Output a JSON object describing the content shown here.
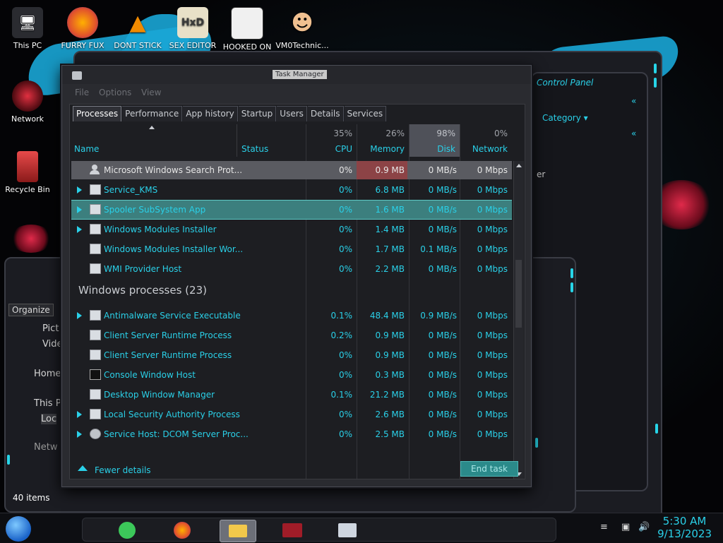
{
  "desktop": {
    "icons": [
      {
        "label": "This PC"
      },
      {
        "label": "FURRY FUX"
      },
      {
        "label": "DONT STICK"
      },
      {
        "label": "SEX EDITOR"
      },
      {
        "label": "HOOKED ON"
      },
      {
        "label": "VM0Technic..."
      },
      {
        "label": "Network"
      },
      {
        "label": "Recycle Bin"
      }
    ]
  },
  "control_panel": {
    "label": "Control Panel",
    "category": "Category",
    "partial": "er"
  },
  "explorer": {
    "organize": "Organize",
    "items": [
      "Pict",
      "Vide",
      "Home",
      "This P",
      "Loc",
      "Netw"
    ],
    "status_items": "40 items"
  },
  "task_manager": {
    "title": "Task Manager",
    "menu": [
      "File",
      "Options",
      "View"
    ],
    "tabs": [
      "Processes",
      "Performance",
      "App history",
      "Startup",
      "Users",
      "Details",
      "Services"
    ],
    "columns": {
      "name": "Name",
      "status": "Status",
      "cpu": {
        "pct": "35%",
        "label": "CPU"
      },
      "memory": {
        "pct": "26%",
        "label": "Memory"
      },
      "disk": {
        "pct": "98%",
        "label": "Disk"
      },
      "network": {
        "pct": "0%",
        "label": "Network"
      }
    },
    "rows_top": [
      {
        "name": "Microsoft Windows Search Prot...",
        "cpu": "0%",
        "mem": "0.9 MB",
        "disk": "0 MB/s",
        "net": "0 Mbps"
      },
      {
        "name": "Service_KMS",
        "cpu": "0%",
        "mem": "6.8 MB",
        "disk": "0 MB/s",
        "net": "0 Mbps"
      },
      {
        "name": "Spooler SubSystem App",
        "cpu": "0%",
        "mem": "1.6 MB",
        "disk": "0 MB/s",
        "net": "0 Mbps"
      },
      {
        "name": "Windows Modules Installer",
        "cpu": "0%",
        "mem": "1.4 MB",
        "disk": "0 MB/s",
        "net": "0 Mbps"
      },
      {
        "name": "Windows Modules Installer Wor...",
        "cpu": "0%",
        "mem": "1.7 MB",
        "disk": "0.1 MB/s",
        "net": "0 Mbps"
      },
      {
        "name": "WMI Provider Host",
        "cpu": "0%",
        "mem": "2.2 MB",
        "disk": "0 MB/s",
        "net": "0 Mbps"
      }
    ],
    "group_label": "Windows processes (23)",
    "rows_windows": [
      {
        "name": "Antimalware Service Executable",
        "cpu": "0.1%",
        "mem": "48.4 MB",
        "disk": "0.9 MB/s",
        "net": "0 Mbps"
      },
      {
        "name": "Client Server Runtime Process",
        "cpu": "0.2%",
        "mem": "0.9 MB",
        "disk": "0 MB/s",
        "net": "0 Mbps"
      },
      {
        "name": "Client Server Runtime Process",
        "cpu": "0%",
        "mem": "0.9 MB",
        "disk": "0 MB/s",
        "net": "0 Mbps"
      },
      {
        "name": "Console Window Host",
        "cpu": "0%",
        "mem": "0.3 MB",
        "disk": "0 MB/s",
        "net": "0 Mbps"
      },
      {
        "name": "Desktop Window Manager",
        "cpu": "0.1%",
        "mem": "21.2 MB",
        "disk": "0 MB/s",
        "net": "0 Mbps"
      },
      {
        "name": "Local Security Authority Process",
        "cpu": "0%",
        "mem": "2.6 MB",
        "disk": "0 MB/s",
        "net": "0 Mbps"
      },
      {
        "name": "Service Host: DCOM Server Proc...",
        "cpu": "0%",
        "mem": "2.5 MB",
        "disk": "0 MB/s",
        "net": "0 Mbps"
      }
    ],
    "fewer_details": "Fewer details",
    "end_task": "End task"
  },
  "taskbar": {
    "time": "5:30 AM",
    "date": "9/13/2023"
  },
  "colors": {
    "accent": "#2ad0e8",
    "selected_row": "#3c7f7e",
    "memory_highlight": "#8c4346"
  }
}
